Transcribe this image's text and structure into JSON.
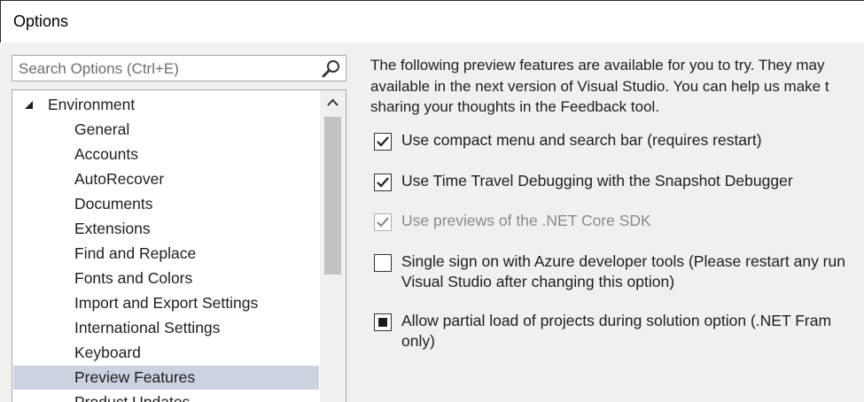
{
  "window": {
    "title": "Options"
  },
  "search": {
    "placeholder": "Search Options (Ctrl+E)"
  },
  "tree": {
    "root": "Environment",
    "items": [
      "General",
      "Accounts",
      "AutoRecover",
      "Documents",
      "Extensions",
      "Find and Replace",
      "Fonts and Colors",
      "Import and Export Settings",
      "International Settings",
      "Keyboard",
      "Preview Features",
      "Product Updates"
    ],
    "selected": "Preview Features"
  },
  "content": {
    "description": [
      "The following preview features are available for you to try. They may",
      "available in the next version of Visual Studio. You can help us make t",
      "sharing your thoughts in the Feedback tool."
    ],
    "options": [
      {
        "lines": [
          "Use compact menu and search bar (requires restart)"
        ],
        "state": "checked",
        "enabled": true
      },
      {
        "lines": [
          "Use Time Travel Debugging with the Snapshot Debugger"
        ],
        "state": "checked",
        "enabled": true
      },
      {
        "lines": [
          "Use previews of the .NET Core SDK"
        ],
        "state": "checked",
        "enabled": false
      },
      {
        "lines": [
          "Single sign on with Azure developer tools (Please restart any run",
          "Visual Studio after changing this option)"
        ],
        "state": "unchecked",
        "enabled": true
      },
      {
        "lines": [
          "Allow partial load of projects during solution option (.NET Fram",
          "only)"
        ],
        "state": "indeterminate",
        "enabled": true
      }
    ]
  },
  "colors": {
    "selection": "#cdd2e0",
    "background": "#f0f0f0"
  }
}
